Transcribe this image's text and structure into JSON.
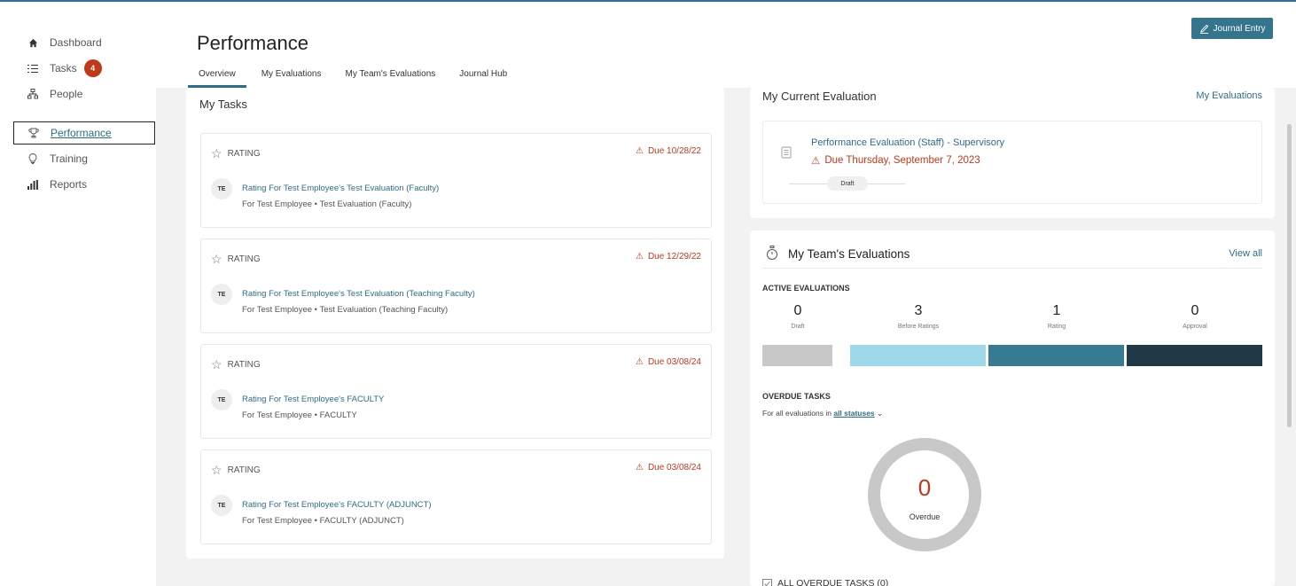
{
  "sidebar": {
    "items": [
      {
        "label": "Dashboard",
        "icon": "home-icon"
      },
      {
        "label": "Tasks",
        "icon": "list-icon",
        "badge": "4"
      },
      {
        "label": "People",
        "icon": "people-icon"
      },
      {
        "label": "Performance",
        "icon": "trophy-icon",
        "active": true
      },
      {
        "label": "Training",
        "icon": "lightbulb-icon"
      },
      {
        "label": "Reports",
        "icon": "bar-chart-icon"
      }
    ]
  },
  "header": {
    "title": "Performance",
    "journal_button": "Journal Entry",
    "tabs": [
      {
        "label": "Overview",
        "active": true
      },
      {
        "label": "My Evaluations"
      },
      {
        "label": "My Team's Evaluations"
      },
      {
        "label": "Journal Hub"
      }
    ]
  },
  "my_tasks": {
    "heading": "My Tasks",
    "tasks": [
      {
        "type": "RATING",
        "due": "Due 10/28/22",
        "initials": "TE",
        "title": "Rating For Test Employee's Test Evaluation (Faculty)",
        "subtitle": "For Test Employee • Test Evaluation (Faculty)"
      },
      {
        "type": "RATING",
        "due": "Due 12/29/22",
        "initials": "TE",
        "title": "Rating For Test Employee's Test Evaluation (Teaching Faculty)",
        "subtitle": "For Test Employee • Test Evaluation (Teaching Faculty)"
      },
      {
        "type": "RATING",
        "due": "Due 03/08/24",
        "initials": "TE",
        "title": "Rating For Test Employee's FACULTY",
        "subtitle": "For Test Employee • FACULTY"
      },
      {
        "type": "RATING",
        "due": "Due 03/08/24",
        "initials": "TE",
        "title": "Rating For Test Employee's FACULTY (ADJUNCT)",
        "subtitle": "For Test Employee • FACULTY (ADJUNCT)"
      }
    ]
  },
  "current_evaluation": {
    "heading": "My Current Evaluation",
    "link": "My Evaluations",
    "title": "Performance Evaluation (Staff) - Supervisory",
    "due": "Due Thursday, September 7, 2023",
    "stage": "Draft"
  },
  "team_evaluations": {
    "heading": "My Team's Evaluations",
    "link": "View all",
    "active_label": "ACTIVE EVALUATIONS",
    "counters": [
      {
        "value": "0",
        "label": "Draft",
        "color": "#c8c8c8"
      },
      {
        "value": "3",
        "label": "Before Ratings",
        "color": "#9dd9ea"
      },
      {
        "value": "1",
        "label": "Rating",
        "color": "#367b8f"
      },
      {
        "value": "0",
        "label": "Approval",
        "color": "#1f3a46"
      }
    ],
    "overdue_label": "OVERDUE TASKS",
    "filter_prefix": "For all evaluations in",
    "filter_link": "all statuses",
    "overdue_count": "0",
    "overdue_text": "Overdue",
    "all_overdue": "ALL OVERDUE TASKS (0)"
  },
  "colors": {
    "accent": "#2c6d8c",
    "danger": "#c4381a",
    "button": "#34748d"
  }
}
